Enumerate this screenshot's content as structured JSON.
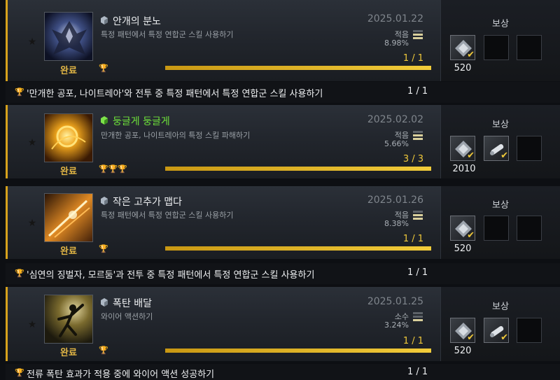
{
  "common": {
    "reward_label": "보상",
    "done_label": "완료",
    "star": "★",
    "check": "✔"
  },
  "achievements": [
    {
      "title": "안개의 분노",
      "title_color": "#eef0f2",
      "description": "특정 패턴에서 특정 연합군 스킬 사용하기",
      "date": "2025.01.22",
      "rarity": "적음",
      "percent": "8.98%",
      "rarity_level": 2,
      "progress_text": "1 / 1",
      "progress": 1.0,
      "trophies": "🏆",
      "reward_count": "520",
      "rewards": [
        "silver-coin-icon"
      ],
      "icon": "dark-dragon-icon",
      "sub_task": {
        "text": "'만개한 공포, 나이트레아'와 전투 중 특정 패턴에서 특정 연합군 스킬 사용하기",
        "count": "1 / 1"
      }
    },
    {
      "title": "둥글게 둥글게",
      "title_color": "#6ee13a",
      "description": "만개한 공포, 나이트레아의 특정 스킬 파해하기",
      "date": "2025.02.02",
      "rarity": "적음",
      "percent": "5.66%",
      "rarity_level": 2,
      "progress_text": "3 / 3",
      "progress": 1.0,
      "trophies": "🏆🏆🏆",
      "reward_count": "2010",
      "rewards": [
        "silver-coin-icon",
        "scroll-icon"
      ],
      "icon": "golden-burst-icon"
    },
    {
      "title": "작은 고추가 맵다",
      "title_color": "#eef0f2",
      "description": "특정 패턴에서 특정 연합군 스킬 사용하기",
      "date": "2025.01.26",
      "rarity": "적음",
      "percent": "8.38%",
      "rarity_level": 2,
      "progress_text": "1 / 1",
      "progress": 1.0,
      "trophies": "🏆",
      "reward_count": "520",
      "rewards": [
        "silver-coin-icon"
      ],
      "icon": "flame-slash-icon",
      "sub_task": {
        "text": "'심연의 징벌자, 모르둠'과 전투 중 특정 패턴에서 특정 연합군 스킬 사용하기",
        "count": "1 / 1"
      }
    },
    {
      "title": "폭탄 배달",
      "title_color": "#eef0f2",
      "description": "와이어 액션하기",
      "date": "2025.01.25",
      "rarity": "소수",
      "percent": "3.24%",
      "rarity_level": 1,
      "progress_text": "1 / 1",
      "progress": 1.0,
      "trophies": "🏆",
      "reward_count": "520",
      "rewards": [
        "silver-coin-icon",
        "scroll-icon"
      ],
      "icon": "wire-action-icon",
      "sub_task": {
        "text": "전류 폭탄 효과가 적용 중에 와이어 액션 성공하기",
        "count": "1 / 1"
      }
    }
  ]
}
